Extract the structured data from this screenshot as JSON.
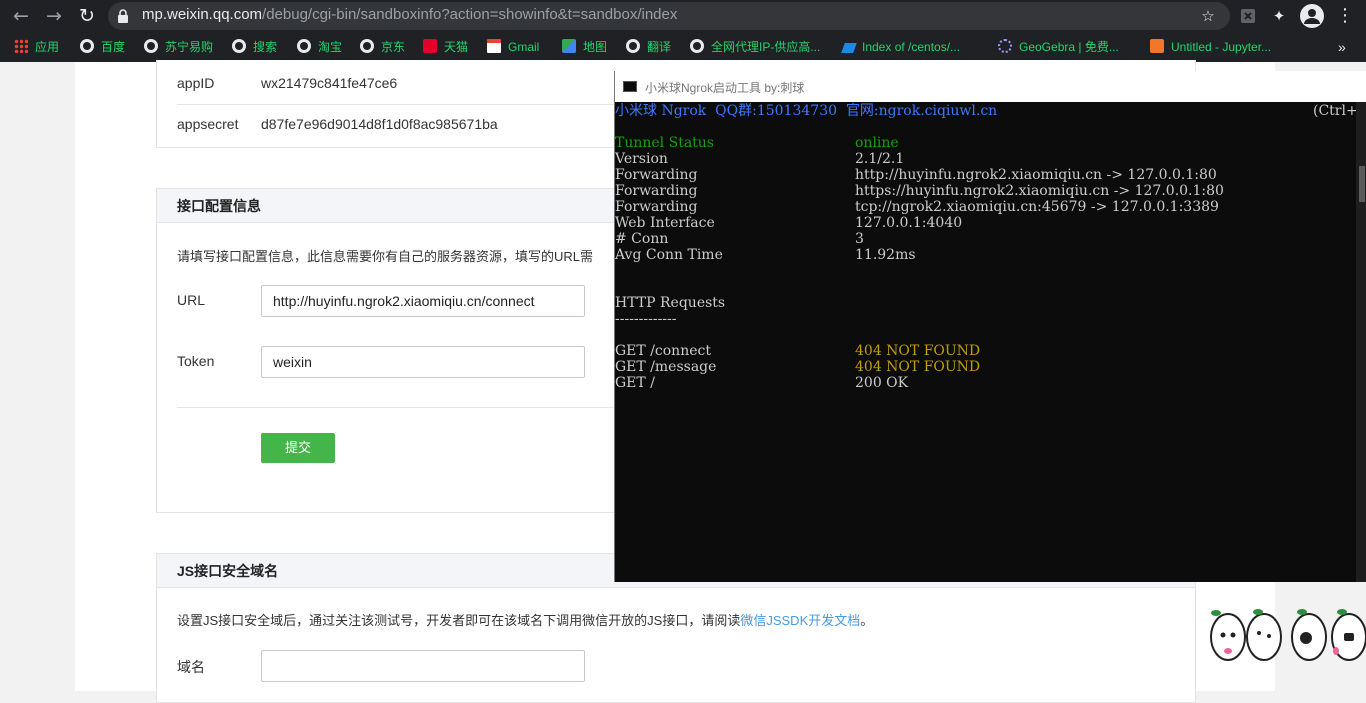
{
  "browser": {
    "url_host": "mp.weixin.qq.com",
    "url_path": "/debug/cgi-bin/sandboxinfo?action=showinfo&t=sandbox/index",
    "bookmarks": [
      "应用",
      "百度",
      "苏宁易购",
      "搜索",
      "淘宝",
      "京东",
      "天猫",
      "Gmail",
      "地图",
      "翻译",
      "全网代理IP-供应高...",
      "Index of /centos/...",
      "GeoGebra | 免费...",
      "Untitled - Jupyter..."
    ],
    "more_label": "»"
  },
  "test_account": {
    "appid_label": "appID",
    "appid_value": "wx21479c841fe47ce6",
    "appsecret_label": "appsecret",
    "appsecret_value": "d87fe7e96d9014d8f1d0f8ac985671ba"
  },
  "interface_config": {
    "title": "接口配置信息",
    "description": "请填写接口配置信息，此信息需要你有自己的服务器资源，填写的URL需",
    "url_label": "URL",
    "url_value": "http://huyinfu.ngrok2.xiaomiqiu.cn/connect",
    "token_label": "Token",
    "token_value": "weixin",
    "submit_label": "提交"
  },
  "js_domain": {
    "title": "JS接口安全域名",
    "description": "设置JS接口安全域后，通过关注该测试号，开发者即可在该域名下调用微信开放的JS接口，请阅读",
    "link_text": "微信JSSDK开发文档",
    "description_end": "。",
    "domain_label": "域名",
    "domain_value": ""
  },
  "terminal": {
    "window_title": "小米球Ngrok启动工具 by:刺球",
    "header_line": "小米球 Ngrok  QQ群:150134730  官网:ngrok.ciqiuwl.cn",
    "header_right": "(Ctrl+C",
    "status_rows": [
      {
        "label": "Tunnel Status",
        "value": "online"
      },
      {
        "label": "Version",
        "value": "2.1/2.1"
      },
      {
        "label": "Forwarding",
        "value": "http://huyinfu.ngrok2.xiaomiqiu.cn -> 127.0.0.1:80"
      },
      {
        "label": "Forwarding",
        "value": "https://huyinfu.ngrok2.xiaomiqiu.cn -> 127.0.0.1:80"
      },
      {
        "label": "Forwarding",
        "value": "tcp://ngrok2.xiaomiqiu.cn:45679 -> 127.0.0.1:3389"
      },
      {
        "label": "Web Interface",
        "value": "127.0.0.1:4040"
      },
      {
        "label": "# Conn",
        "value": "3"
      },
      {
        "label": "Avg Conn Time",
        "value": "11.92ms"
      }
    ],
    "requests_title": "HTTP Requests",
    "requests_rule": "-------------",
    "requests": [
      {
        "path": "GET /connect",
        "status": "404 NOT FOUND"
      },
      {
        "path": "GET /message",
        "status": "404 NOT FOUND"
      },
      {
        "path": "GET /",
        "status": "200 OK"
      }
    ],
    "colors": {
      "header": "#3b78ff",
      "online": "#13a10e",
      "error": "#c19c00",
      "text": "#cccccc"
    }
  }
}
